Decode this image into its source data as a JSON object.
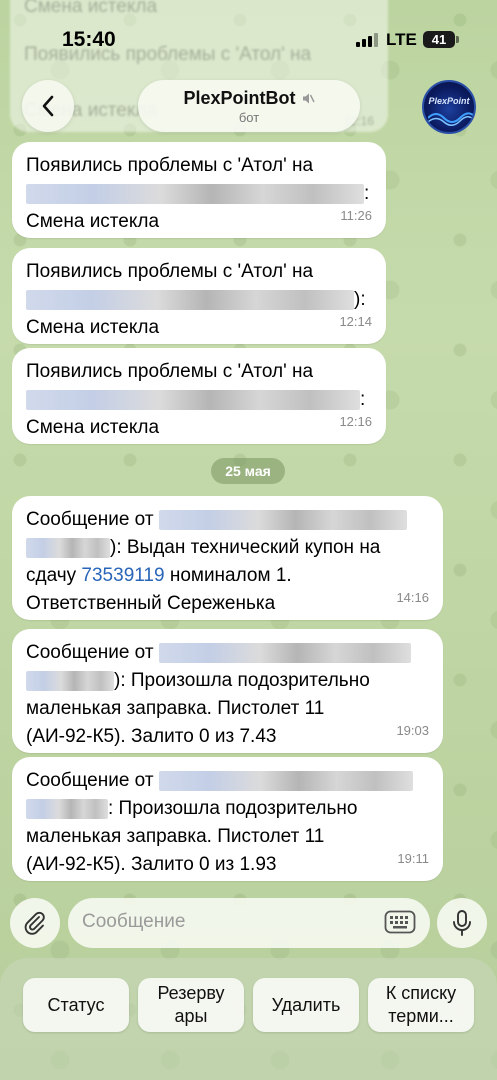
{
  "status_bar": {
    "time": "15:40",
    "network": "LTE",
    "battery": "41"
  },
  "header": {
    "title": "PlexPointBot",
    "subtitle": "бот",
    "avatar_text": "PlexPoint"
  },
  "ghost_top": {
    "line1": "Смена истекла",
    "line2": "Появились проблемы с 'Атол' на",
    "line3": "Смена истекла",
    "time": "12:16"
  },
  "messages": [
    {
      "line1": "Появились проблемы с 'Атол' на",
      "line2_suffix": ":",
      "line3": "Смена истекла",
      "time": "11:26"
    },
    {
      "line1": "Появились проблемы с 'Атол' на",
      "line2_suffix": "):",
      "line3": "Смена истекла",
      "time": "12:14"
    },
    {
      "line1": "Появились проблемы с 'Атол' на",
      "line2_suffix": ":",
      "line3": "Смена истекла",
      "time": "12:16"
    }
  ],
  "date_separator": "25 мая",
  "messages2": [
    {
      "line1": "Сообщение от",
      "line2": "): Выдан технический купон на",
      "line3_pre": "сдачу ",
      "coupon": "73539119",
      "line3_post": " номиналом 1.",
      "line4": "Ответственный Сереженька",
      "time": "14:16"
    },
    {
      "line1": "Сообщение от",
      "line2": "): Произошла подозрительно",
      "line3": "маленькая заправка. Пистолет 11",
      "line4": "(АИ-92-К5). Залито 0 из 7.43",
      "time": "19:03"
    },
    {
      "line1": "Сообщение от",
      "line2": ": Произошла подозрительно",
      "line3": "маленькая заправка. Пистолет 11",
      "line4": "(АИ-92-К5). Залито 0 из 1.93",
      "time": "19:11"
    }
  ],
  "input": {
    "placeholder": "Сообщение"
  },
  "bot_keyboard": [
    {
      "label": "Статус"
    },
    {
      "label": "Резерву\nары"
    },
    {
      "label": "Удалить"
    },
    {
      "label": "К списку\nтерми..."
    }
  ]
}
